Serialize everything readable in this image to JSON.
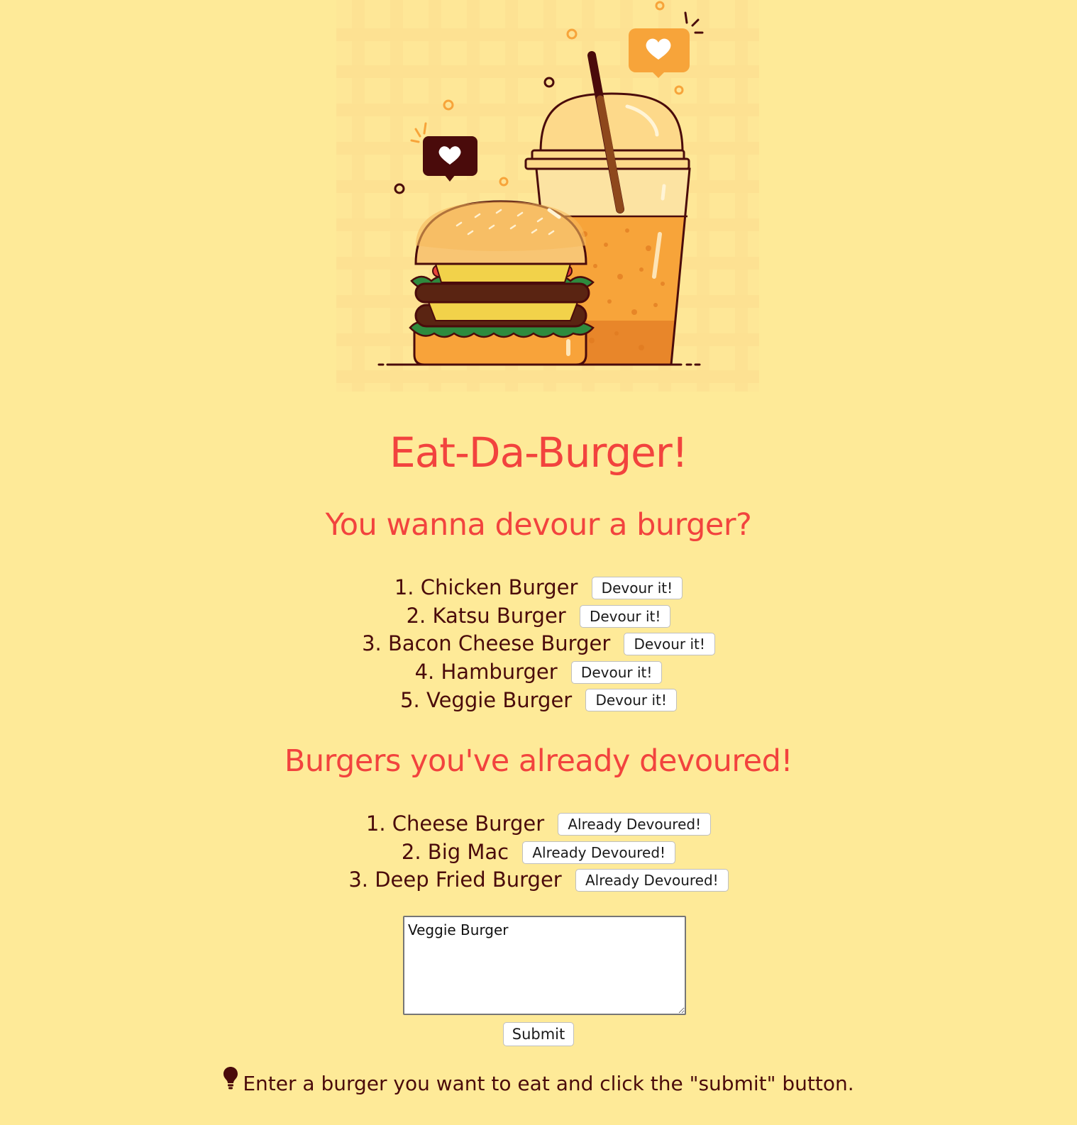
{
  "page": {
    "title": "Eat-Da-Burger!"
  },
  "to_devour": {
    "heading": "You wanna devour a burger?",
    "items": [
      {
        "label": "1. Chicken Burger",
        "button": "Devour it!"
      },
      {
        "label": "2. Katsu Burger",
        "button": "Devour it!"
      },
      {
        "label": "3. Bacon Cheese Burger",
        "button": "Devour it!"
      },
      {
        "label": "4. Hamburger",
        "button": "Devour it!"
      },
      {
        "label": "5. Veggie Burger",
        "button": "Devour it!"
      }
    ]
  },
  "devoured": {
    "heading": "Burgers you've already devoured!",
    "items": [
      {
        "label": "1. Cheese Burger",
        "button": "Already Devoured!"
      },
      {
        "label": "2. Big Mac",
        "button": "Already Devoured!"
      },
      {
        "label": "3. Deep Fried Burger",
        "button": "Already Devoured!"
      }
    ]
  },
  "form": {
    "textarea_value": "Veggie Burger",
    "submit_label": "Submit"
  },
  "hint": {
    "icon": "lightbulb-icon",
    "text": "Enter a burger you want to eat and click the \"submit\" button."
  },
  "colors": {
    "background": "#FEEA98",
    "heading": "#F2433E",
    "text": "#4A0B0B"
  }
}
